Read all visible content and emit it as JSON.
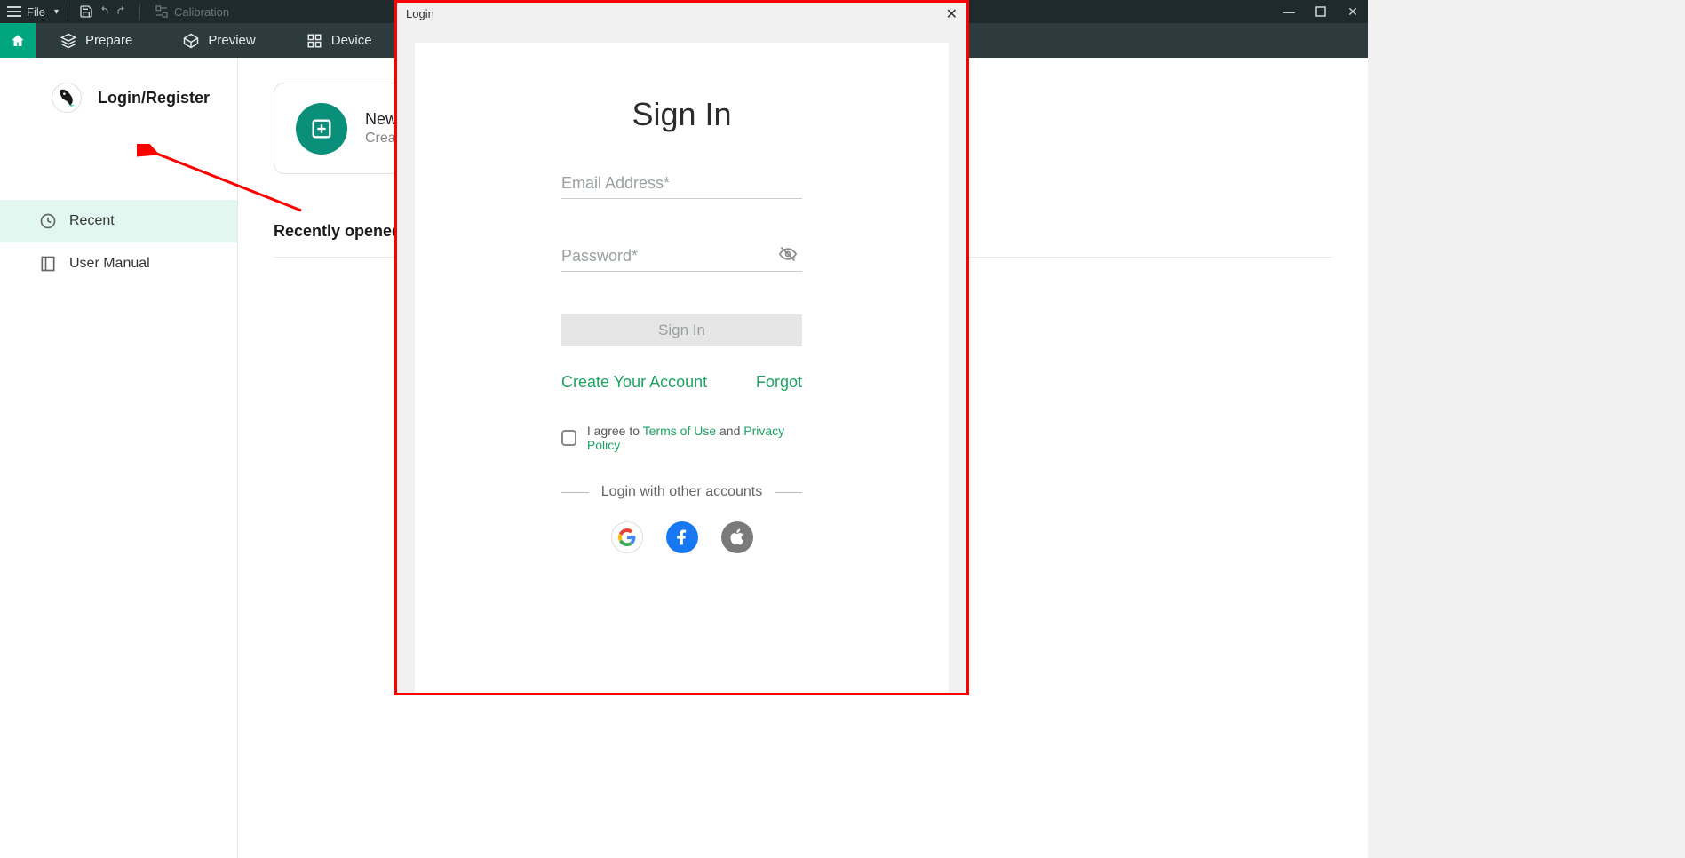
{
  "titlebar": {
    "file_label": "File",
    "calibration_label": "Calibration"
  },
  "tabs": {
    "prepare": "Prepare",
    "preview": "Preview",
    "device": "Device"
  },
  "sidebar": {
    "login_register": "Login/Register",
    "recent": "Recent",
    "user_manual": "User Manual"
  },
  "content": {
    "new_project_title": "New P",
    "new_project_sub": "Create",
    "recently_opened": "Recently opened"
  },
  "modal": {
    "window_title": "Login",
    "heading": "Sign In",
    "email_placeholder": "Email Address*",
    "password_placeholder": "Password*",
    "signin_btn": "Sign In",
    "create_account": "Create Your Account",
    "forgot": "Forgot",
    "agree_prefix": "I agree to ",
    "terms": "Terms of Use",
    "agree_and": " and ",
    "privacy": "Privacy Policy",
    "other_accounts": "Login with other accounts"
  }
}
